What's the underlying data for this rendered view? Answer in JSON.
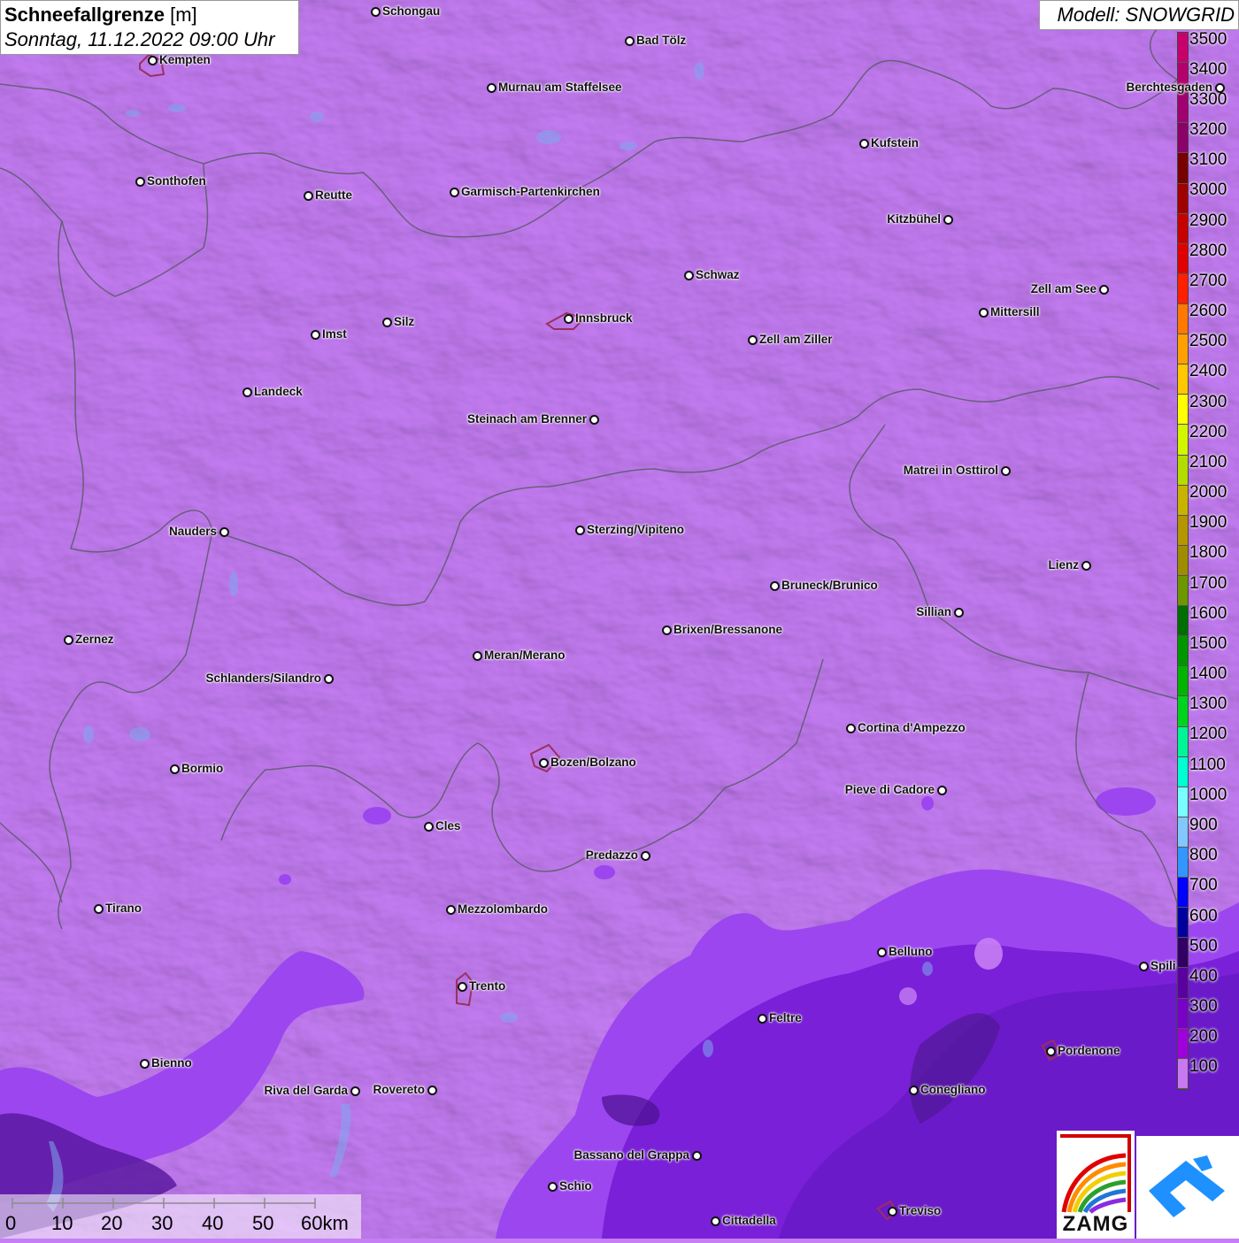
{
  "title": {
    "bold": "Schneefallgrenze",
    "unit": "[m]",
    "datetime": "Sonntag, 11.12.2022 09:00 Uhr"
  },
  "model": "Modell: SNOWGRID",
  "legend": {
    "labels": [
      "3500",
      "3400",
      "3300",
      "3200",
      "3100",
      "3000",
      "2900",
      "2800",
      "2700",
      "2600",
      "2500",
      "2400",
      "2300",
      "2200",
      "2100",
      "2000",
      "1900",
      "1800",
      "1700",
      "1600",
      "1500",
      "1400",
      "1300",
      "1200",
      "1100",
      "1000",
      "900",
      "800",
      "700",
      "600",
      "500",
      "400",
      "300",
      "200",
      "100"
    ],
    "colors": [
      "#c8006e",
      "#b4006c",
      "#a00070",
      "#8c006a",
      "#780000",
      "#a00000",
      "#c80000",
      "#e00000",
      "#ff2000",
      "#ff7800",
      "#ffa000",
      "#ffc800",
      "#ffff00",
      "#d2f500",
      "#b4dc00",
      "#c8b400",
      "#b49600",
      "#a08c00",
      "#6e9600",
      "#006e00",
      "#009600",
      "#00b400",
      "#00d21e",
      "#00f596",
      "#00ffd2",
      "#78ffff",
      "#82c8ff",
      "#3296ff",
      "#0000ff",
      "#0000a0",
      "#320064",
      "#5a00a0",
      "#7800c8",
      "#a000dc",
      "#c878f0"
    ]
  },
  "cities": [
    {
      "name": "Schongau"
    },
    {
      "name": "Bad Tölz"
    },
    {
      "name": "Kempten"
    },
    {
      "name": "Murnau am Staffelsee"
    },
    {
      "name": "Berchtesgaden"
    },
    {
      "name": "Kufstein"
    },
    {
      "name": "Sonthofen"
    },
    {
      "name": "Reutte"
    },
    {
      "name": "Garmisch-Partenkirchen"
    },
    {
      "name": "Kitzbühel"
    },
    {
      "name": "Schwaz"
    },
    {
      "name": "Zell am See"
    },
    {
      "name": "Innsbruck"
    },
    {
      "name": "Mittersill"
    },
    {
      "name": "Imst"
    },
    {
      "name": "Silz"
    },
    {
      "name": "Zell am Ziller"
    },
    {
      "name": "Landeck"
    },
    {
      "name": "Steinach am Brenner"
    },
    {
      "name": "Matrei in Osttirol"
    },
    {
      "name": "Nauders"
    },
    {
      "name": "Sterzing/Vipiteno"
    },
    {
      "name": "Lienz"
    },
    {
      "name": "Bruneck/Brunico"
    },
    {
      "name": "Sillian"
    },
    {
      "name": "Zernez"
    },
    {
      "name": "Brixen/Bressanone"
    },
    {
      "name": "Meran/Merano"
    },
    {
      "name": "Schlanders/Silandro"
    },
    {
      "name": "Cortina d'Ampezzo"
    },
    {
      "name": "Bozen/Bolzano"
    },
    {
      "name": "Bormio"
    },
    {
      "name": "Pieve di Cadore"
    },
    {
      "name": "Cles"
    },
    {
      "name": "Predazzo"
    },
    {
      "name": "Tirano"
    },
    {
      "name": "Mezzolombardo"
    },
    {
      "name": "Belluno"
    },
    {
      "name": "Spili"
    },
    {
      "name": "Trento"
    },
    {
      "name": "Feltre"
    },
    {
      "name": "Pordenone"
    },
    {
      "name": "Bienno"
    },
    {
      "name": "Riva del Garda"
    },
    {
      "name": "Rovereto"
    },
    {
      "name": "Conegliano"
    },
    {
      "name": "Bassano del Grappa"
    },
    {
      "name": "Schio"
    },
    {
      "name": "Treviso"
    },
    {
      "name": "Cittadella"
    }
  ],
  "scale": {
    "labels": [
      "0",
      "10",
      "20",
      "30",
      "40",
      "50",
      "60km"
    ]
  },
  "logos": {
    "zamg": "ZAMG"
  }
}
